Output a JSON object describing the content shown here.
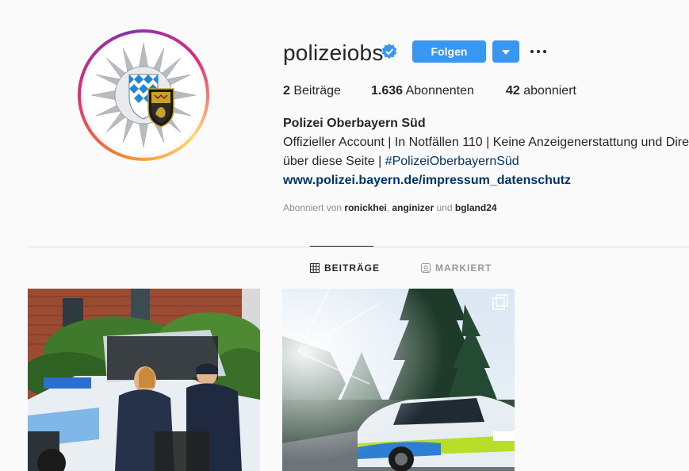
{
  "profile": {
    "username": "polizeiobs",
    "verified_icon": "verified-badge-icon",
    "follow_label": "Folgen",
    "stats": {
      "posts_count": "2",
      "posts_label": "Beiträge",
      "followers_count": "1.636",
      "followers_label": "Abonnenten",
      "following_count": "42",
      "following_label": "abonniert"
    },
    "full_name": "Polizei Oberbayern Süd",
    "bio_line1": "Offizieller Account | In Notfällen 110 | Keine Anzeigenerstattung und Dire",
    "bio_line2_prefix": "über diese Seite | ",
    "bio_hashtag": "#PolizeiOberbayernSüd",
    "website": "www.polizei.bayern.de/impressum_datenschutz",
    "followed_by": {
      "prefix": "Abonniert von",
      "user1": "ronickhei",
      "sep": ",",
      "user2": "anginizer",
      "and": "und",
      "user3": "bgland24"
    }
  },
  "tabs": [
    {
      "label": "BEITRÄGE",
      "icon": "grid-icon",
      "active": true
    },
    {
      "label": "MARKIERT",
      "icon": "tagged-icon",
      "active": false
    }
  ],
  "colors": {
    "accent": "#3897f0",
    "link": "#003569",
    "muted": "#8e8e8e",
    "text": "#262626"
  }
}
